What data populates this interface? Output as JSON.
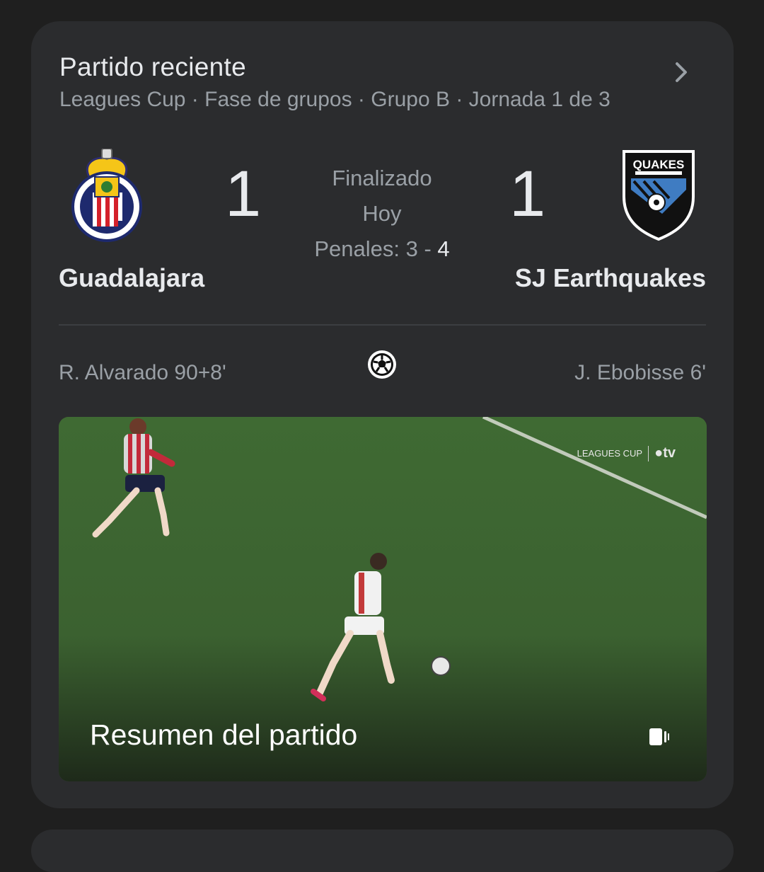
{
  "card": {
    "title": "Partido reciente",
    "subtitle": "Leagues Cup · Fase de grupos · Grupo B · Jornada 1 de 3",
    "chevron_icon": "chevron-right-icon"
  },
  "match": {
    "home": {
      "name": "Guadalajara",
      "score": "1",
      "logo": "guadalajara-crest-icon",
      "scorer": "R. Alvarado 90+8'"
    },
    "away": {
      "name": "SJ Earthquakes",
      "score": "1",
      "logo": "quakes-crest-icon",
      "scorer": "J. Ebobisse 6'"
    },
    "status": "Finalizado",
    "date": "Hoy",
    "penalties_label": "Penales:",
    "penalties_home": "3",
    "penalties_sep": " - ",
    "penalties_away": "4",
    "goal_icon": "soccer-ball-icon"
  },
  "video": {
    "title": "Resumen del partido",
    "brand_text": "LEAGUES CUP",
    "brand_tv": "tv",
    "icon": "vertical-video-icon"
  },
  "colors": {
    "background": "#1f1f1f",
    "card": "#2b2c2e",
    "text_primary": "#e8eaed",
    "text_secondary": "#9aa0a6",
    "pitch": "#3c5a2e"
  }
}
